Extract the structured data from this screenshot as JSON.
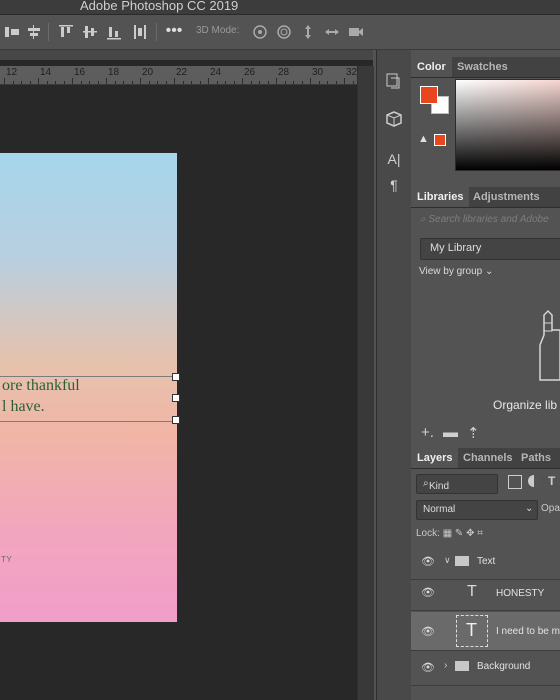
{
  "app": {
    "title": "Adobe Photoshop CC 2019"
  },
  "options": {
    "mode3d_label": "3D Mode:"
  },
  "ruler": {
    "ticks": [
      "12",
      "14",
      "16",
      "18",
      "20",
      "22",
      "24",
      "26",
      "28",
      "30",
      "32"
    ]
  },
  "document": {
    "text_line1": "ore thankful",
    "text_line2": "l have.",
    "small_text": "TY"
  },
  "panels": {
    "color_tabs": [
      "Color",
      "Swatches"
    ],
    "library_tabs": [
      "Libraries",
      "Adjustments"
    ],
    "library_search_placeholder": "Search libraries and Adobe",
    "library_selected": "My Library",
    "view_by": "View by group",
    "organize": "Organize lib",
    "layer_tabs": [
      "Layers",
      "Channels",
      "Paths"
    ],
    "kind_filter": "Kind",
    "blend_mode": "Normal",
    "opacity_label": "Opa",
    "lock_label": "Lock:",
    "layers": [
      {
        "name": "Text",
        "type": "group"
      },
      {
        "name": "HONESTY",
        "type": "text"
      },
      {
        "name": "I need to be m",
        "type": "text"
      },
      {
        "name": "Background",
        "type": "group"
      }
    ]
  },
  "colors": {
    "foreground": "#e8471e",
    "background": "#ffffff",
    "text_green": "#2a5e3a"
  }
}
